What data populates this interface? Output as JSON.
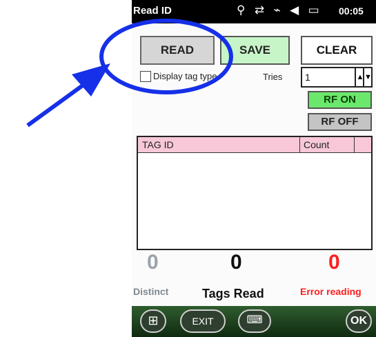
{
  "app": {
    "title": "Read ID"
  },
  "statusbar": {
    "time": "00:05",
    "icons": [
      "signal-antenna-icon",
      "sync-arrows-icon",
      "connection-icon",
      "volume-icon",
      "battery-icon"
    ]
  },
  "buttons": {
    "read": "READ",
    "save": "SAVE",
    "clear": "CLEAR",
    "rf_on": "RF ON",
    "rf_off": "RF OFF"
  },
  "options": {
    "display_tag_type_label": "Display tag type",
    "display_tag_type_checked": false,
    "tries_label": "Tries",
    "tries_value": "1"
  },
  "table": {
    "columns": [
      "TAG ID",
      "Count"
    ],
    "rows": []
  },
  "stats": {
    "distinct": {
      "value": "0",
      "label": "Distinct"
    },
    "tags_read": {
      "value": "0",
      "label": "Tags Read"
    },
    "errors": {
      "value": "0",
      "label": "Error reading"
    }
  },
  "bottombar": {
    "exit": "EXIT",
    "ok": "OK"
  },
  "colors": {
    "accent_green": "#6be86b",
    "save_green": "#c8f5c8",
    "header_pink": "#f8c8d8",
    "error_red": "#ff1e1e",
    "annotation_blue": "#1530e8"
  }
}
